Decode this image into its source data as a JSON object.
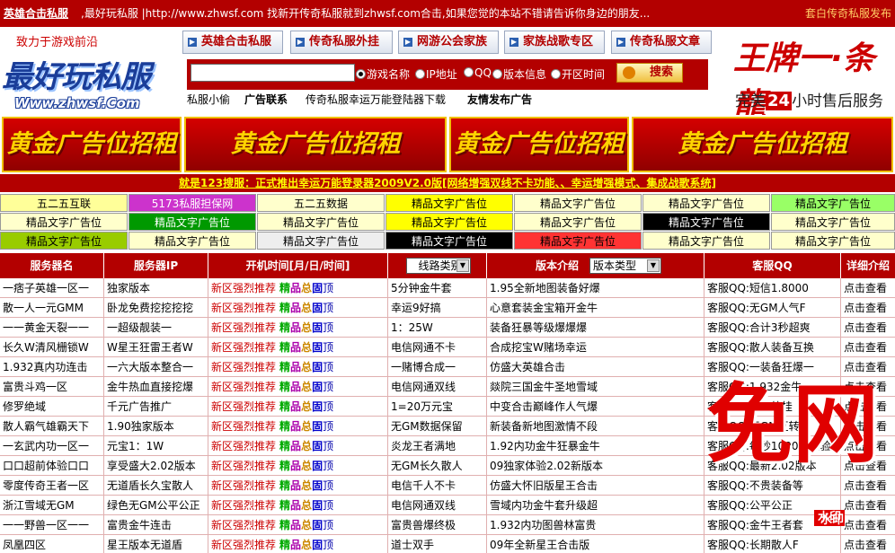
{
  "topbar": {
    "site_name": "英雄合击私服",
    "message": ",最好玩私服 |http://www.zhwsf.com 找新开传奇私服就到zhwsf.com合击,如果您觉的本站不错请告诉你身边的朋友...",
    "right_link": "套白传奇私服发布"
  },
  "logo": {
    "slogan": "致力于游戏前沿",
    "name": "最好玩私服",
    "url": "Www.zhwsf.Com"
  },
  "nav": {
    "tabs": [
      "英雄合击私服",
      "传奇私服外挂",
      "网游公会家族",
      "家族战歌专区",
      "传奇私服文章"
    ]
  },
  "search": {
    "input_value": "",
    "options": [
      "游戏名称",
      "IP地址",
      "QQ",
      "版本信息",
      "开区时间"
    ],
    "selected": 0,
    "button": "搜索"
  },
  "sublinks": [
    "私服小偷",
    "广告联系",
    "传奇私服幸运万能登陆器下载",
    "友情发布广告"
  ],
  "king_banner": {
    "title": "王牌一·条龍",
    "sub_prefix": "完美",
    "sub_num": "24",
    "sub_suffix": "小时售后服务"
  },
  "gold_ads": [
    "黄金广告位招租",
    "黄金广告位招租",
    "黄金广告位招租",
    "黄金广告位招租"
  ],
  "announcement": "就是123搜服：正式推出幸运万能登录器2009V2.0版[网络增强双线不卡功能、、幸运增强模式、集成战歌系统]",
  "text_ads": [
    [
      {
        "text": "五二五互联",
        "bg": "#ffff99",
        "fg": "#000000"
      },
      {
        "text": "5173私服担保网",
        "bg": "#cc33cc",
        "fg": "#ffffff"
      },
      {
        "text": "五二五数据",
        "bg": "#ffffcc",
        "fg": "#000000"
      },
      {
        "text": "精品文字广告位",
        "bg": "#ffff00",
        "fg": "#000000"
      },
      {
        "text": "精品文字广告位",
        "bg": "#ffffcc",
        "fg": "#000000"
      },
      {
        "text": "精品文字广告位",
        "bg": "#ffffcc",
        "fg": "#000000"
      },
      {
        "text": "精品文字广告位",
        "bg": "#99ff66",
        "fg": "#000000"
      }
    ],
    [
      {
        "text": "精品文字广告位",
        "bg": "#ffffcc",
        "fg": "#000000"
      },
      {
        "text": "精品文字广告位",
        "bg": "#009900",
        "fg": "#ffffff"
      },
      {
        "text": "精品文字广告位",
        "bg": "#ffffcc",
        "fg": "#000000"
      },
      {
        "text": "精品文字广告位",
        "bg": "#ffff00",
        "fg": "#000000"
      },
      {
        "text": "精品文字广告位",
        "bg": "#ffffcc",
        "fg": "#000000"
      },
      {
        "text": "精品文字广告位",
        "bg": "#000000",
        "fg": "#ffffff"
      },
      {
        "text": "精品文字广告位",
        "bg": "#ffffcc",
        "fg": "#000000"
      }
    ],
    [
      {
        "text": "精品文字广告位",
        "bg": "#99cc00",
        "fg": "#000000"
      },
      {
        "text": "精品文字广告位",
        "bg": "#ffffcc",
        "fg": "#000000"
      },
      {
        "text": "精品文字广告位",
        "bg": "#eeeeee",
        "fg": "#000000"
      },
      {
        "text": "精品文字广告位",
        "bg": "#000000",
        "fg": "#ffffff"
      },
      {
        "text": "精品文字广告位",
        "bg": "#ff3333",
        "fg": "#000000"
      },
      {
        "text": "精品文字广告位",
        "bg": "#ffffcc",
        "fg": "#000000"
      },
      {
        "text": "精品文字广告位",
        "bg": "#ffffcc",
        "fg": "#000000"
      }
    ]
  ],
  "table": {
    "headers": [
      "服务器名",
      "服务器IP",
      "开机时间[月/日/时间]",
      "线路类别",
      "版本介绍",
      "版本类型",
      "客服QQ",
      "详细介绍"
    ],
    "recommend": [
      "新区强烈推荐",
      "精",
      "品",
      "总",
      "固",
      "顶"
    ],
    "detail": "点击查看",
    "rows": [
      [
        "一痞子英雄一区一",
        "独家版本",
        "5分钟金牛套",
        "1.95全新地图装备好爆",
        "客服QQ:短信1.8000"
      ],
      [
        "散一人一元GMM",
        "卧龙免费挖挖挖挖",
        "幸运9好搞",
        "心意套装金宝箱开金牛",
        "客服QQ:无GM人气F"
      ],
      [
        "一一黄金天裂一一",
        "一超级靓装一",
        "1：25W",
        "装备狂暴等级爆爆爆",
        "客服QQ:合计3秒超爽"
      ],
      [
        "长久W清风栅锁W",
        "W星王狂雷王者W",
        "电信网通不卡",
        "合成挖宝W赌场幸运",
        "客服QQ:散人装备互换"
      ],
      [
        "1.932真内功连击",
        "一六大版本整合一",
        "一赌博合成一",
        "仿盛大英雄合击",
        "客服QQ:一装备狂爆一"
      ],
      [
        "富贵斗鸡一区",
        "金牛热血直接挖爆",
        "电信网通双线",
        "燚院三国金牛圣地雪域",
        "客服QQ:1.932金牛"
      ],
      [
        "修罗绝域",
        "千元广告推广",
        "1=20万元宝",
        "中变合击巅峰作人气爆",
        "客服QQ:无切外挂"
      ],
      [
        "散人霸气雄霸天下",
        "1.90独家版本",
        "无GM数据保留",
        "新装备新地图激情不段",
        "客服QQ:无GM互转"
      ],
      [
        "一玄武内功一区一",
        "元宝1：1W",
        "炎龙王者满地",
        "1.92内功金牛狂暴金牛",
        "客服QQ:每秒1000W经验"
      ],
      [
        "口口超前体验口口",
        "享受盛大2.02版本",
        "无GM长久散人",
        "09独家体验2.02新版本",
        "客服QQ:最新2.02版本"
      ],
      [
        "零度传奇王者一区",
        "无道盾长久宝散人",
        "电信千人不卡",
        "仿盛大怀旧版星王合击",
        "客服QQ:不贵装备等"
      ],
      [
        "浙江雪域无GM",
        "绿色无GM公平公正",
        "电信网通双线",
        "雪域内功金牛套升级超",
        "客服QQ:公平公正"
      ],
      [
        "一一野兽一区一一",
        "富贵金牛连击",
        "富贵兽爆终极",
        "1.932内功图兽林富贵",
        "客服QQ:金牛王者套"
      ],
      [
        "凤凰四区",
        "星王版本无道盾",
        "道士双手",
        "09年全新星王合击版",
        "客服QQ:长期散人F"
      ]
    ]
  },
  "watermark": {
    "text": "免网",
    "tag": "水印"
  }
}
